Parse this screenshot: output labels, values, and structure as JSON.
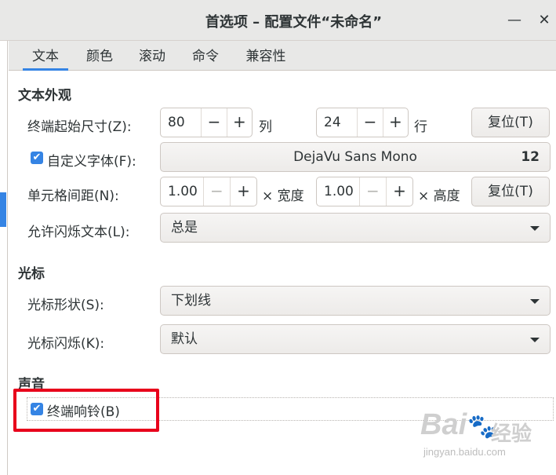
{
  "window": {
    "title": "首选项 – 配置文件“未命名”",
    "minimize_symbol": "—",
    "close_symbol": "✕"
  },
  "tabs": [
    {
      "label": "文本",
      "active": true
    },
    {
      "label": "颜色",
      "active": false
    },
    {
      "label": "滚动",
      "active": false
    },
    {
      "label": "命令",
      "active": false
    },
    {
      "label": "兼容性",
      "active": false
    }
  ],
  "text_appearance": {
    "section_title": "文本外观",
    "initial_size_label": "终端起始尺寸(Z):",
    "columns_value": "80",
    "columns_unit": "列",
    "rows_value": "24",
    "rows_unit": "行",
    "reset_size_label": "复位(T)",
    "custom_font_label": "自定义字体(F):",
    "custom_font_checked": true,
    "font_name": "DejaVu Sans Mono",
    "font_size": "12",
    "cell_spacing_label": "单元格间距(N):",
    "width_value": "1.00",
    "width_unit": "× 宽度",
    "height_value": "1.00",
    "height_unit": "× 高度",
    "reset_spacing_label": "复位(T)",
    "blink_text_label": "允许闪烁文本(L):",
    "blink_text_value": "总是"
  },
  "cursor": {
    "section_title": "光标",
    "shape_label": "光标形状(S):",
    "shape_value": "下划线",
    "blink_label": "光标闪烁(K):",
    "blink_value": "默认"
  },
  "sound": {
    "section_title": "声音",
    "bell_label": "终端响铃(B)",
    "bell_checked": true
  },
  "watermark": {
    "logo_text": "Bai",
    "logo_paw": "du",
    "logo_cn": "经验",
    "url": "jingyan.baidu.com"
  },
  "colors": {
    "accent": "#3584e4",
    "highlight_box": "#e8001b"
  },
  "spin": {
    "minus": "−",
    "plus": "+"
  }
}
